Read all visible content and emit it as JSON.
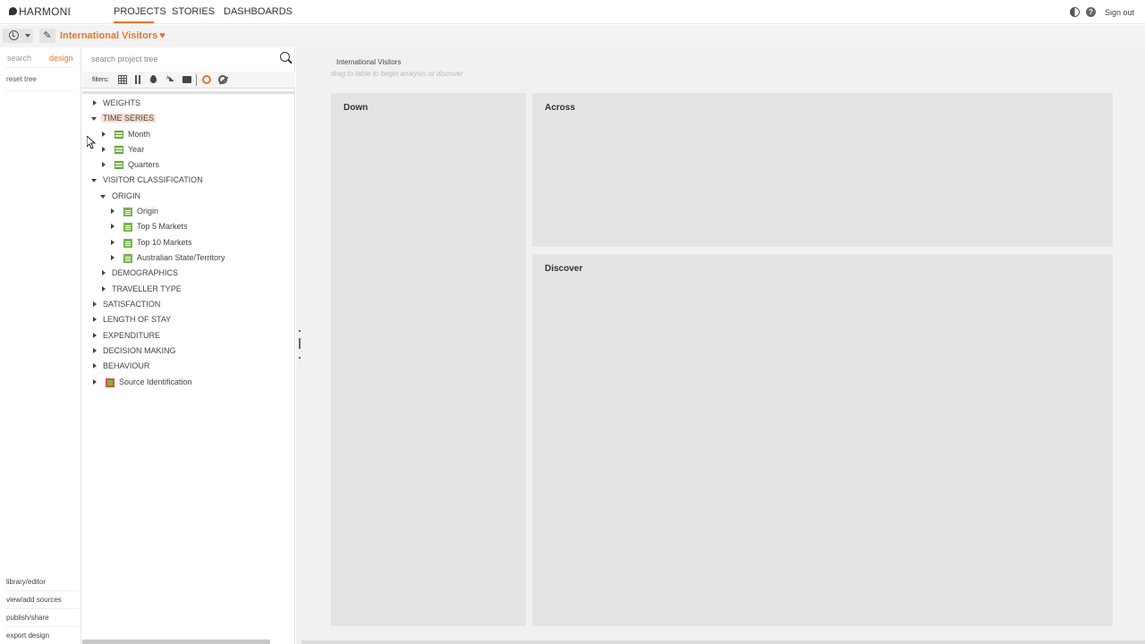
{
  "app": {
    "logo": "HARMONI",
    "nav": [
      "PROJECTS",
      "STORIES",
      "DASHBOARDS"
    ],
    "signout": "Sign out"
  },
  "toolbar": {
    "project_title": "International Visitors"
  },
  "leftcol": {
    "tabs": [
      "search",
      "design"
    ],
    "reset_tree": "reset tree",
    "bottom_links": [
      "library/editor",
      "view/add sources",
      "publish/share",
      "export design"
    ]
  },
  "tree": {
    "search_placeholder": "search project tree",
    "filters_label": "filters:",
    "nodes": [
      {
        "label": "WEIGHTS"
      },
      {
        "label": "TIME SERIES"
      },
      {
        "label": "Month"
      },
      {
        "label": "Year"
      },
      {
        "label": "Quarters"
      },
      {
        "label": "VISITOR CLASSIFICATION"
      },
      {
        "label": "ORIGIN"
      },
      {
        "label": "Origin"
      },
      {
        "label": "Top 5 Markets"
      },
      {
        "label": "Top 10 Markets"
      },
      {
        "label": "Australian State/Territory"
      },
      {
        "label": "DEMOGRAPHICS"
      },
      {
        "label": "TRAVELLER TYPE"
      },
      {
        "label": "SATISFACTION"
      },
      {
        "label": "LENGTH OF STAY"
      },
      {
        "label": "EXPENDITURE"
      },
      {
        "label": "DECISION MAKING"
      },
      {
        "label": "BEHAVIOUR"
      },
      {
        "label": "Source Identification"
      }
    ]
  },
  "main": {
    "title": "International Visitors",
    "hint": "drag to table to begin analysis or discover",
    "zones": {
      "down": "Down",
      "across": "Across",
      "discover": "Discover"
    }
  },
  "colors": {
    "accent": "#e8752a",
    "tree_icon_green": "#79b548",
    "highlight": "#f6dfd2"
  }
}
